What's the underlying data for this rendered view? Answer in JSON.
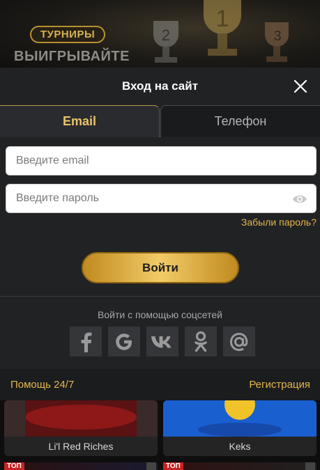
{
  "background": {
    "badge": "ТУРНИРЫ",
    "title": "ВЫИГРЫВАЙТЕ"
  },
  "modal": {
    "title": "Вход на сайт",
    "tabs": [
      {
        "label": "Email",
        "active": true
      },
      {
        "label": "Телефон",
        "active": false
      }
    ],
    "email_placeholder": "Введите email",
    "password_placeholder": "Введите пароль",
    "forgot_label": "Забыли пароль?",
    "login_label": "Войти",
    "social_title": "Войти с помощью соцсетей",
    "socials": [
      "facebook-icon",
      "google-icon",
      "vk-icon",
      "odnoklassniki-icon",
      "mail-icon"
    ],
    "footer": {
      "help_label": "Помощь 24/7",
      "register_label": "Регистрация"
    }
  },
  "games": [
    {
      "name": "Li'l Red Riches"
    },
    {
      "name": "Keks"
    }
  ],
  "game_badges": {
    "top_label": "ТОП"
  },
  "colors": {
    "accent": "#e4b84c",
    "modal_bg": "#212224",
    "button_gold": "#f2cb67"
  }
}
